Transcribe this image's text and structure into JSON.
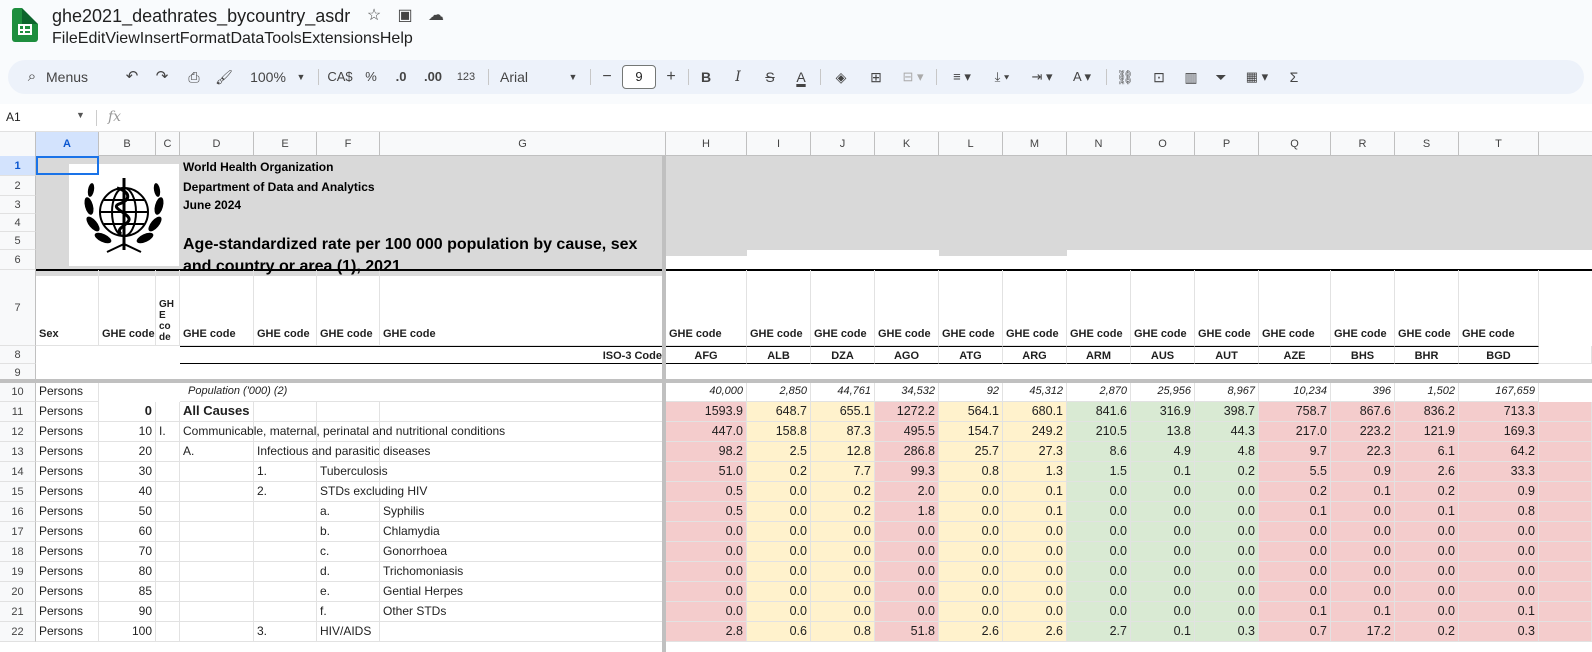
{
  "app": {
    "title": "ghe2021_deathrates_bycountry_asdr",
    "menus": [
      "File",
      "Edit",
      "View",
      "Insert",
      "Format",
      "Data",
      "Tools",
      "Extensions",
      "Help"
    ]
  },
  "toolbar": {
    "search_label": "Menus",
    "zoom": "100%",
    "currency": "CA$",
    "percent": "%",
    "dec_less": ".0",
    "dec_more": ".00",
    "format123": "123",
    "font": "Arial",
    "font_size": "9"
  },
  "formula": {
    "cell_ref": "A1",
    "fx": "fx"
  },
  "columns": [
    "A",
    "B",
    "C",
    "D",
    "E",
    "F",
    "G",
    "H",
    "I",
    "J",
    "K",
    "L",
    "M",
    "N",
    "O",
    "P",
    "Q",
    "R",
    "S",
    "T"
  ],
  "rows": [
    "1",
    "2",
    "3",
    "4",
    "5",
    "6",
    "7",
    "8",
    "9",
    "10",
    "11",
    "12",
    "13",
    "14",
    "15",
    "16",
    "17",
    "18",
    "19",
    "20",
    "21",
    "22"
  ],
  "header": {
    "org": "World Health Organization",
    "dept": "Department of Data and Analytics",
    "date": "June 2024",
    "title_line1": "Age-standardized rate per 100 000 population by cause, sex",
    "title_line2": "and country or area (1), 2021"
  },
  "row7": {
    "sex": "Sex",
    "ghe": "GHE code",
    "ghe_c_lines": [
      "GH",
      "E",
      "co",
      "de"
    ]
  },
  "iso_label": "ISO-3 Code",
  "countries": [
    "AFG",
    "ALB",
    "DZA",
    "AGO",
    "ATG",
    "ARG",
    "ARM",
    "AUS",
    "AUT",
    "AZE",
    "BHS",
    "BHR",
    "BGD"
  ],
  "population": {
    "label": "Population ('000) (2)",
    "values": [
      "40,000",
      "2,850",
      "44,761",
      "34,532",
      "92",
      "45,312",
      "2,870",
      "25,956",
      "8,967",
      "10,234",
      "396",
      "1,502",
      "167,659"
    ]
  },
  "data_rows": [
    {
      "sex": "Persons",
      "code": "0",
      "c": "",
      "d": "All Causes",
      "e": "",
      "f": "",
      "g": "",
      "bold": true,
      "values": [
        "1593.9",
        "648.7",
        "655.1",
        "1272.2",
        "564.1",
        "680.1",
        "841.6",
        "316.9",
        "398.7",
        "758.7",
        "867.6",
        "836.2",
        "713.3"
      ]
    },
    {
      "sex": "Persons",
      "code": "10",
      "c": "I.",
      "d": "Communicable, maternal, perinatal and nutritional conditions",
      "e": "",
      "f": "",
      "g": "",
      "values": [
        "447.0",
        "158.8",
        "87.3",
        "495.5",
        "154.7",
        "249.2",
        "210.5",
        "13.8",
        "44.3",
        "217.0",
        "223.2",
        "121.9",
        "169.3"
      ]
    },
    {
      "sex": "Persons",
      "code": "20",
      "c": "",
      "d": "A.",
      "e": "Infectious and parasitic diseases",
      "f": "",
      "g": "",
      "values": [
        "98.2",
        "2.5",
        "12.8",
        "286.8",
        "25.7",
        "27.3",
        "8.6",
        "4.9",
        "4.8",
        "9.7",
        "22.3",
        "6.1",
        "64.2"
      ]
    },
    {
      "sex": "Persons",
      "code": "30",
      "c": "",
      "d": "",
      "e": "1.",
      "f": "Tuberculosis",
      "g": "",
      "values": [
        "51.0",
        "0.2",
        "7.7",
        "99.3",
        "0.8",
        "1.3",
        "1.5",
        "0.1",
        "0.2",
        "5.5",
        "0.9",
        "2.6",
        "33.3"
      ]
    },
    {
      "sex": "Persons",
      "code": "40",
      "c": "",
      "d": "",
      "e": "2.",
      "f": "STDs excluding HIV",
      "g": "",
      "values": [
        "0.5",
        "0.0",
        "0.2",
        "2.0",
        "0.0",
        "0.1",
        "0.0",
        "0.0",
        "0.0",
        "0.2",
        "0.1",
        "0.2",
        "0.9"
      ]
    },
    {
      "sex": "Persons",
      "code": "50",
      "c": "",
      "d": "",
      "e": "",
      "f": "a.",
      "g": "Syphilis",
      "values": [
        "0.5",
        "0.0",
        "0.2",
        "1.8",
        "0.0",
        "0.1",
        "0.0",
        "0.0",
        "0.0",
        "0.1",
        "0.0",
        "0.1",
        "0.8"
      ]
    },
    {
      "sex": "Persons",
      "code": "60",
      "c": "",
      "d": "",
      "e": "",
      "f": "b.",
      "g": "Chlamydia",
      "values": [
        "0.0",
        "0.0",
        "0.0",
        "0.0",
        "0.0",
        "0.0",
        "0.0",
        "0.0",
        "0.0",
        "0.0",
        "0.0",
        "0.0",
        "0.0"
      ]
    },
    {
      "sex": "Persons",
      "code": "70",
      "c": "",
      "d": "",
      "e": "",
      "f": "c.",
      "g": "Gonorrhoea",
      "values": [
        "0.0",
        "0.0",
        "0.0",
        "0.0",
        "0.0",
        "0.0",
        "0.0",
        "0.0",
        "0.0",
        "0.0",
        "0.0",
        "0.0",
        "0.0"
      ]
    },
    {
      "sex": "Persons",
      "code": "80",
      "c": "",
      "d": "",
      "e": "",
      "f": "d.",
      "g": "Trichomoniasis",
      "values": [
        "0.0",
        "0.0",
        "0.0",
        "0.0",
        "0.0",
        "0.0",
        "0.0",
        "0.0",
        "0.0",
        "0.0",
        "0.0",
        "0.0",
        "0.0"
      ]
    },
    {
      "sex": "Persons",
      "code": "85",
      "c": "",
      "d": "",
      "e": "",
      "f": "e.",
      "g": "Gential Herpes",
      "values": [
        "0.0",
        "0.0",
        "0.0",
        "0.0",
        "0.0",
        "0.0",
        "0.0",
        "0.0",
        "0.0",
        "0.0",
        "0.0",
        "0.0",
        "0.0"
      ]
    },
    {
      "sex": "Persons",
      "code": "90",
      "c": "",
      "d": "",
      "e": "",
      "f": "f.",
      "g": "Other STDs",
      "values": [
        "0.0",
        "0.0",
        "0.0",
        "0.0",
        "0.0",
        "0.0",
        "0.0",
        "0.0",
        "0.0",
        "0.1",
        "0.1",
        "0.0",
        "0.1"
      ]
    },
    {
      "sex": "Persons",
      "code": "100",
      "c": "",
      "d": "",
      "e": "3.",
      "f": "HIV/AIDS",
      "g": "",
      "values": [
        "2.8",
        "0.6",
        "0.8",
        "51.8",
        "2.6",
        "2.6",
        "2.7",
        "0.1",
        "0.3",
        "0.7",
        "17.2",
        "0.2",
        "0.3"
      ]
    }
  ],
  "colors": {
    "pink": "#f4cccc",
    "yellow": "#fff2cc",
    "green": "#d9ead3",
    "grey": "#d9d9d9",
    "accent": "#1a73e8"
  },
  "col_colors": [
    "pink",
    "yellow",
    "yellow",
    "pink",
    "yellow",
    "yellow",
    "green",
    "green",
    "green",
    "pink",
    "pink",
    "pink",
    "pink"
  ]
}
